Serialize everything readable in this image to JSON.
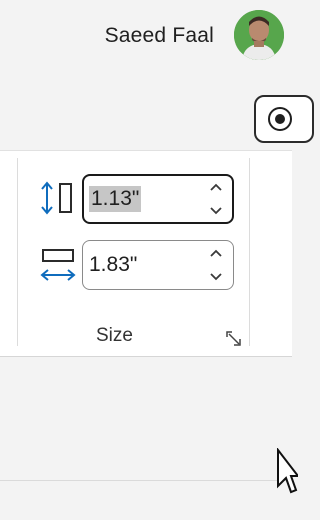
{
  "header": {
    "user_name": "Saeed Faal",
    "avatar_icon": "user-avatar-photo"
  },
  "toolbar": {
    "record_icon": "record-icon"
  },
  "size_group": {
    "label": "Size",
    "height_value": "1.13\"",
    "width_value": "1.83\"",
    "height_icon": "shape-height-icon",
    "width_icon": "shape-width-icon",
    "spinner_up_icon": "chevron-up-icon",
    "spinner_down_icon": "chevron-down-icon",
    "dialog_launcher_icon": "dialog-launcher-icon"
  },
  "colors": {
    "accent": "#0f6cbd",
    "text": "#202020",
    "surface": "#ffffff",
    "background": "#f3f3f3",
    "selection": "#c6c6c6"
  }
}
